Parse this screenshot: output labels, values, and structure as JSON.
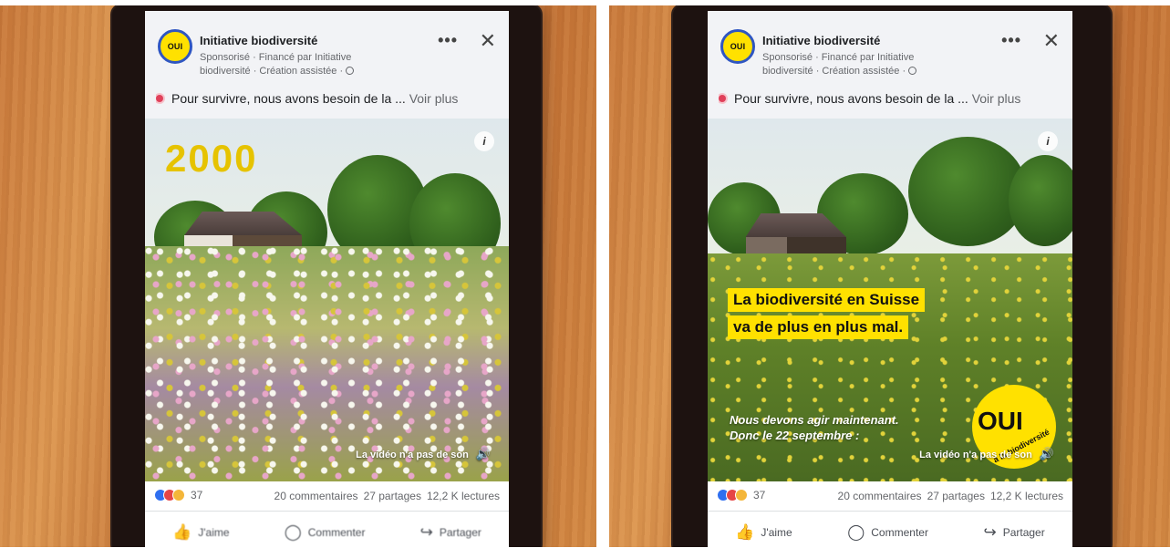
{
  "post": {
    "page_name": "Initiative biodiversité",
    "meta": "Sponsorisé · Financé par Initiative biodiversité · Création assistée ·",
    "logo_text": "OUI",
    "caption": "Pour survivre, nous avons besoin de la ...",
    "see_more": "Voir plus",
    "info_label": "i",
    "no_sound": "La vidéo n'a pas de son",
    "reaction_count": "37",
    "comments": "20 commentaires",
    "shares": "27 partages",
    "views": "12,2 K lectures",
    "like": "J'aime",
    "comment": "Commenter",
    "share": "Partager"
  },
  "left_frame": {
    "year": "2000"
  },
  "right_frame": {
    "headline_1": "La biodiversité en Suisse",
    "headline_2": "va de plus en plus mal.",
    "call_1": "Nous devons agir maintenant.",
    "call_2": "Donc le 22 septembre :",
    "badge_big": "OUI",
    "badge_small": "à la biodiversité"
  },
  "colors": {
    "accent_yellow": "#ffe100",
    "logo_ring": "#2f56c2",
    "desk": "#d48a44"
  },
  "icons": [
    "more-icon",
    "close-icon",
    "globe-icon",
    "info-icon",
    "speaker-icon",
    "thumbs-up-icon",
    "comment-icon",
    "share-icon"
  ]
}
